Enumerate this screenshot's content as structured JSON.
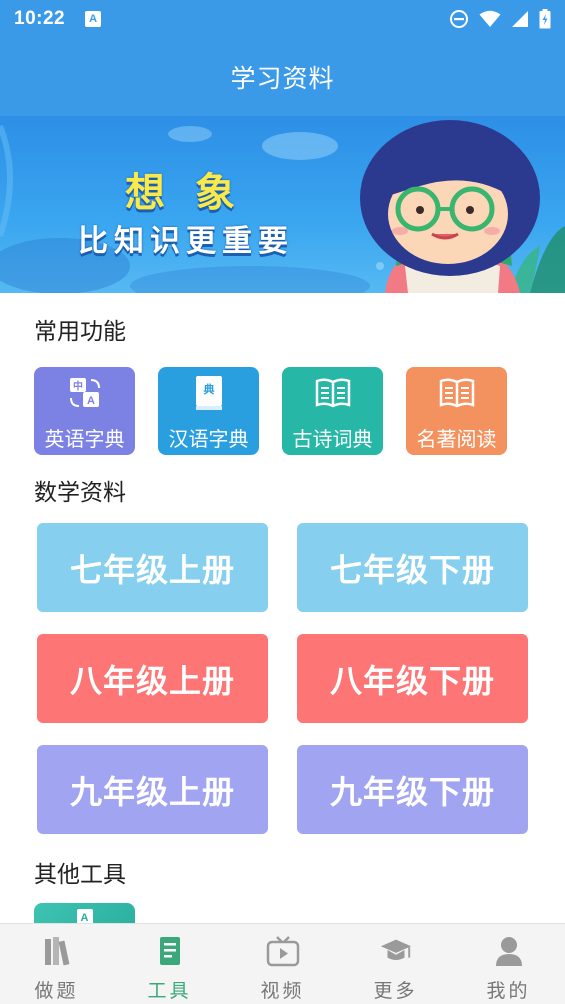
{
  "status_bar": {
    "time": "10:22",
    "notification_icon": "A"
  },
  "app_bar": {
    "title": "学习资料"
  },
  "banner": {
    "line1": "想象",
    "line2": "比知识更重要"
  },
  "sections": {
    "common": "常用功能",
    "math": "数学资料",
    "other": "其他工具"
  },
  "functions": [
    {
      "label": "英语字典",
      "icon": "translate-icon",
      "color": "#7c81e4"
    },
    {
      "label": "汉语字典",
      "icon": "dictionary-book-icon",
      "color": "#2a9fe0"
    },
    {
      "label": "古诗词典",
      "icon": "open-book-icon",
      "color": "#27b7a6"
    },
    {
      "label": "名著阅读",
      "icon": "open-book-icon",
      "color": "#f3915f"
    }
  ],
  "grades": [
    {
      "label": "七年级上册",
      "color": "#86cfee"
    },
    {
      "label": "七年级下册",
      "color": "#86cfee"
    },
    {
      "label": "八年级上册",
      "color": "#fd7575"
    },
    {
      "label": "八年级下册",
      "color": "#fd7575"
    },
    {
      "label": "九年级上册",
      "color": "#a1a5f1"
    },
    {
      "label": "九年级下册",
      "color": "#a1a5f1"
    }
  ],
  "other_tools": {
    "tile_icon": "A"
  },
  "bottom_nav": [
    {
      "label": "做题",
      "icon": "books-icon",
      "active": false
    },
    {
      "label": "工具",
      "icon": "document-icon",
      "active": true
    },
    {
      "label": "视频",
      "icon": "tv-icon",
      "active": false
    },
    {
      "label": "更多",
      "icon": "graduation-cap-icon",
      "active": false
    },
    {
      "label": "我的",
      "icon": "person-icon",
      "active": false
    }
  ],
  "colors": {
    "primary": "#3b9ae8",
    "nav_active": "#3ba87b",
    "nav_inactive": "#9a9a9a"
  }
}
